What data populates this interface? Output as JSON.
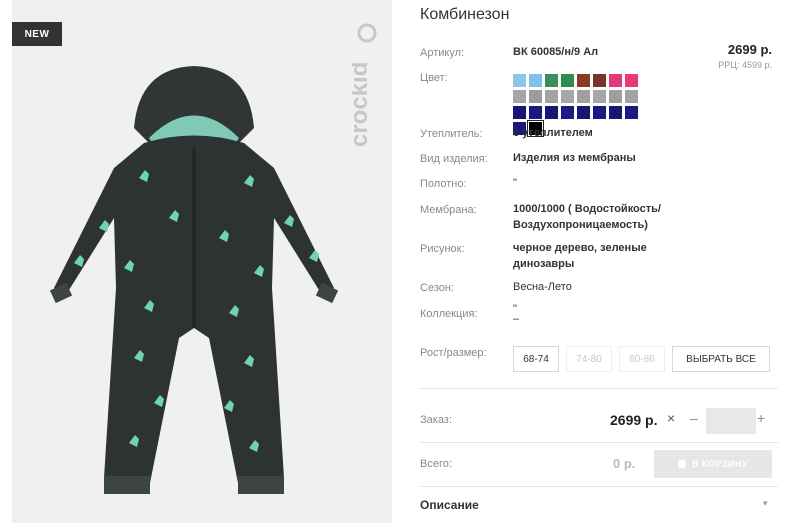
{
  "product": {
    "badge": "NEW",
    "brand_logo_text": "crockid",
    "title": "Комбинезон",
    "price": "2699 р.",
    "rrp": "РРЦ: 4599 р.",
    "image_icon": "overall-jumpsuit-image"
  },
  "specs": [
    {
      "label": "Артикул:",
      "value": "ВК 60085/н/9 Ал"
    },
    {
      "label": "Цвет:",
      "value": ""
    },
    {
      "label": "Утеплитель:",
      "value": "с утеплителем"
    },
    {
      "label": "Вид изделия:",
      "value": "Изделия из мембраны"
    },
    {
      "label": "Полотно:",
      "value": "\""
    },
    {
      "label": "Мембрана:",
      "value": "1000/1000 ( Водостойкость/ Воздухопроницаемость)"
    },
    {
      "label": "Рисунок:",
      "value": "черное дерево, зеленые динозавры"
    },
    {
      "label": "Сезон:",
      "value": "Весна-Лето"
    },
    {
      "label": "Коллекция:",
      "value": "\"\n–"
    }
  ],
  "colors": [
    "#8ec6e8",
    "#7fc1ea",
    "#3a8f5a",
    "#2f8a52",
    "#8b3a2a",
    "#7a3328",
    "#e03a7a",
    "#e83a74",
    "#a5a5a5",
    "#9c9c9c",
    "#a3a3a3",
    "#a8a8a8",
    "#a0a0a0",
    "#a6a6a6",
    "#9e9e9e",
    "#a2a2a2",
    "#1a1478",
    "#1c1880",
    "#1b1676",
    "#1e1a84",
    "#1a1570",
    "#1d1882",
    "#1a1675",
    "#1c1983",
    "#1b1677",
    "#000000"
  ],
  "sizes": {
    "label": "Рост/размер:",
    "options": [
      {
        "text": "68-74",
        "enabled": true
      },
      {
        "text": "74-80",
        "enabled": false
      },
      {
        "text": "80-86",
        "enabled": false
      }
    ],
    "select_all": "ВЫБРАТЬ ВСЕ"
  },
  "order": {
    "label": "Заказ:",
    "price": "2699 р.",
    "remove_icon": "×",
    "minus": "–",
    "plus": "+",
    "qty": ""
  },
  "total": {
    "label": "Всего:",
    "value": "0 р.",
    "cart_button": "В КОРЗИНУ"
  },
  "description": {
    "label": "Описание",
    "chevron": "▾"
  }
}
